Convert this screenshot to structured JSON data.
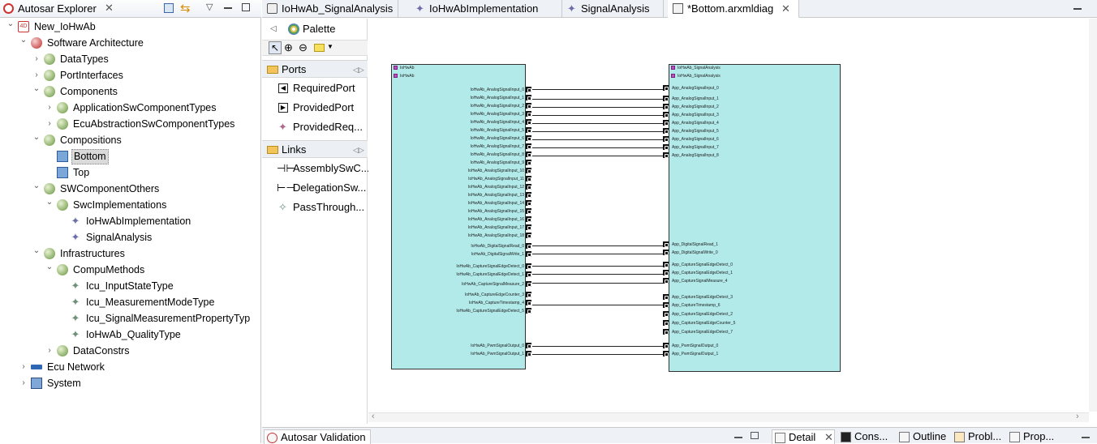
{
  "explorer": {
    "title": "Autosar Explorer",
    "tree": [
      {
        "label": "New_IoHwAb",
        "level": 0,
        "expanded": true,
        "icon": "project-icon"
      },
      {
        "label": "Software Architecture",
        "level": 1,
        "expanded": true,
        "icon": "package-red-icon"
      },
      {
        "label": "DataTypes",
        "level": 2,
        "expanded": false,
        "icon": "package-icon"
      },
      {
        "label": "PortInterfaces",
        "level": 2,
        "expanded": false,
        "icon": "package-icon"
      },
      {
        "label": "Components",
        "level": 2,
        "expanded": true,
        "icon": "package-icon"
      },
      {
        "label": "ApplicationSwComponentTypes",
        "level": 3,
        "expanded": false,
        "icon": "package-icon"
      },
      {
        "label": "EcuAbstractionSwComponentTypes",
        "level": 3,
        "expanded": false,
        "icon": "package-icon"
      },
      {
        "label": "Compositions",
        "level": 2,
        "expanded": true,
        "icon": "package-icon"
      },
      {
        "label": "Bottom",
        "level": 3,
        "leaf": true,
        "selected": true,
        "icon": "composition-icon"
      },
      {
        "label": "Top",
        "level": 3,
        "leaf": true,
        "icon": "composition-icon"
      },
      {
        "label": "SWComponentOthers",
        "level": 2,
        "expanded": true,
        "icon": "package-icon"
      },
      {
        "label": "SwcImplementations",
        "level": 3,
        "expanded": true,
        "icon": "package-icon"
      },
      {
        "label": "IoHwAbImplementation",
        "level": 4,
        "leaf": true,
        "icon": "implementation-icon"
      },
      {
        "label": "SignalAnalysis",
        "level": 4,
        "leaf": true,
        "icon": "implementation-icon"
      },
      {
        "label": "Infrastructures",
        "level": 2,
        "expanded": true,
        "icon": "package-icon"
      },
      {
        "label": "CompuMethods",
        "level": 3,
        "expanded": true,
        "icon": "package-icon"
      },
      {
        "label": "Icu_InputStateType",
        "level": 4,
        "leaf": true,
        "icon": "compu-method-icon"
      },
      {
        "label": "Icu_MeasurementModeType",
        "level": 4,
        "leaf": true,
        "icon": "compu-method-icon"
      },
      {
        "label": "Icu_SignalMeasurementPropertyTyp",
        "level": 4,
        "leaf": true,
        "icon": "compu-method-icon"
      },
      {
        "label": "IoHwAb_QualityType",
        "level": 4,
        "leaf": true,
        "icon": "compu-method-icon"
      },
      {
        "label": "DataConstrs",
        "level": 3,
        "expanded": false,
        "icon": "package-icon"
      },
      {
        "label": "Ecu Network",
        "level": 1,
        "expanded": false,
        "icon": "network-icon"
      },
      {
        "label": "System",
        "level": 1,
        "expanded": false,
        "icon": "system-icon"
      }
    ]
  },
  "editor_tabs": [
    {
      "label": "IoHwAb_SignalAnalysis",
      "active": false
    },
    {
      "label": "IoHwAbImplementation",
      "active": false
    },
    {
      "label": "SignalAnalysis",
      "active": false
    },
    {
      "label": "*Bottom.arxmldiag",
      "active": true
    }
  ],
  "palette": {
    "title": "Palette",
    "ports_header": "Ports",
    "ports": [
      "RequiredPort",
      "ProvidedPort",
      "ProvidedReq..."
    ],
    "links_header": "Links",
    "links": [
      "AssemblySwC...",
      "DelegationSw...",
      "PassThrough..."
    ]
  },
  "diagram": {
    "left_component": {
      "headers": [
        "IoHwAb",
        "IoHwAb"
      ],
      "ports": [
        "IoHwAb_AnalogSignalInput_0",
        "IoHwAb_AnalogSignalInput_1",
        "IoHwAb_AnalogSignalInput_2",
        "IoHwAb_AnalogSignalInput_3",
        "IoHwAb_AnalogSignalInput_4",
        "IoHwAb_AnalogSignalInput_5",
        "IoHwAb_AnalogSignalInput_6",
        "IoHwAb_AnalogSignalInput_7",
        "IoHwAb_AnalogSignalInput_8",
        "IoHwAb_AnalogSignalInput_9",
        "IoHwAb_AnalogSignalInput_10",
        "IoHwAb_AnalogSignalInput_11",
        "IoHwAb_AnalogSignalInput_12",
        "IoHwAb_AnalogSignalInput_13",
        "IoHwAb_AnalogSignalInput_14",
        "IoHwAb_AnalogSignalInput_15",
        "IoHwAb_AnalogSignalInput_16",
        "IoHwAb_AnalogSignalInput_17",
        "IoHwAb_AnalogSignalInput_18",
        "IoHwAb_DigitalSignalRead_0",
        "IoHwAb_DigitalSignalWrite_1",
        "IoHwAb_CaptureSignalEdgeDetect_0",
        "IoHwAb_CaptureSignalEdgeDetect_1",
        "IoHwAb_CaptureSignalMeasure_2",
        "IoHwAb_CaptureEdgeCounter_3",
        "IoHwAb_CaptureTimestamp_4",
        "IoHwAb_CaptureSignalEdgeDetect_5",
        "IoHwAb_PwmSignalOutput_0",
        "IoHwAb_PwmSignalOutput_1"
      ]
    },
    "right_component": {
      "headers": [
        "IoHwAb_SignalAnalysis",
        "IoHwAb_SignalAnalysis"
      ],
      "ports": [
        "App_AnalogSignalInput_0",
        "App_AnalogSignalInput_1",
        "App_AnalogSignalInput_2",
        "App_AnalogSignalInput_3",
        "App_AnalogSignalInput_4",
        "App_AnalogSignalInput_5",
        "App_AnalogSignalInput_6",
        "App_AnalogSignalInput_7",
        "App_AnalogSignalInput_8",
        "App_DigitalSignalRead_1",
        "App_DigitalSignalWrite_0",
        "App_CaptureSignalEdgeDetect_0",
        "App_CaptureSignalEdgeDetect_1",
        "App_CaptureSignalMeasure_4",
        "App_CaptureSignalEdgeDetect_3",
        "App_CaptureTimestamp_6",
        "App_CaptureSignalEdgeDetect_2",
        "App_CaptureSignalEdgeCounter_5",
        "App_CaptureSignalEdgeDetect_7",
        "App_PwmSignalOutput_0",
        "App_PwmSignalOutput_1"
      ]
    }
  },
  "bottom_tabs": [
    "Autosar Validation",
    "Detail",
    "Cons...",
    "Outline",
    "Probl...",
    "Prop..."
  ]
}
